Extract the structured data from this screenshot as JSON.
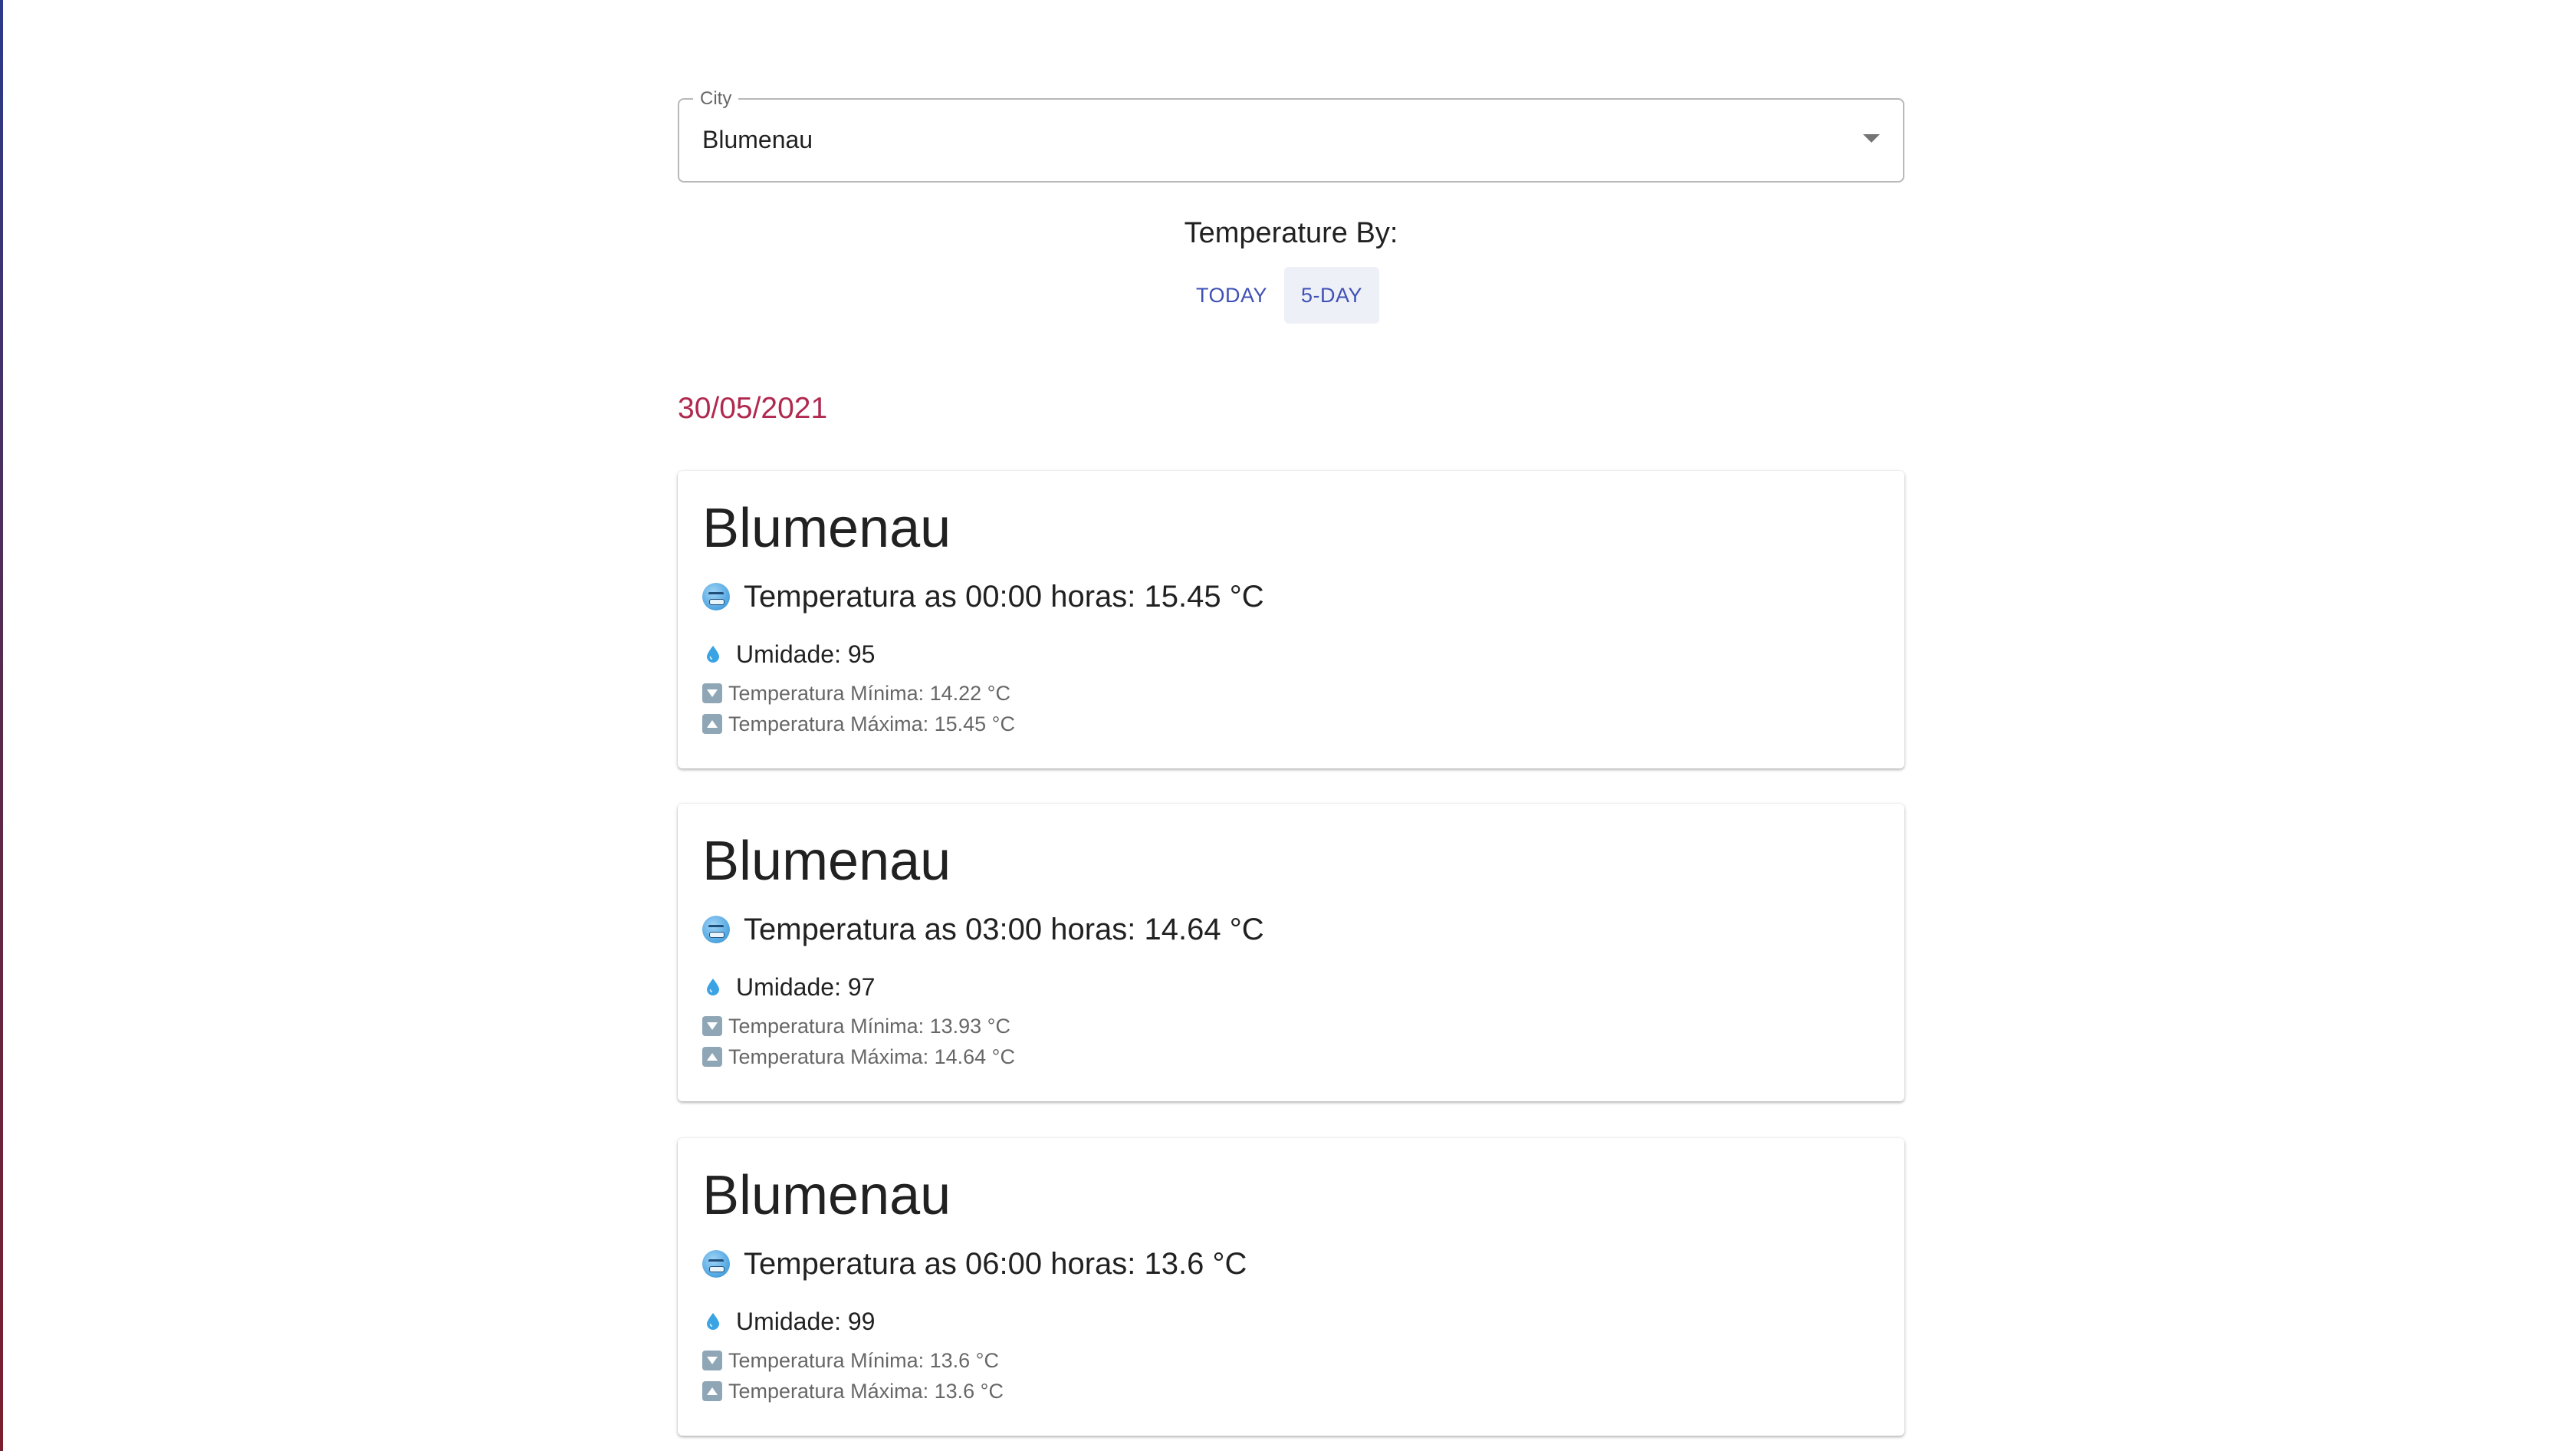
{
  "city_select": {
    "label": "City",
    "value": "Blumenau"
  },
  "temperature_by": {
    "heading": "Temperature By:",
    "options": [
      {
        "label": "TODAY",
        "selected": false
      },
      {
        "label": "5-DAY",
        "selected": true
      }
    ]
  },
  "date": "30/05/2021",
  "cards": [
    {
      "city": "Blumenau",
      "temperature": "Temperatura as 00:00 horas: 15.45 °C",
      "humidity": "Umidade: 95",
      "min": "Temperatura Mínima: 14.22 °C",
      "max": "Temperatura Máxima: 15.45 °C"
    },
    {
      "city": "Blumenau",
      "temperature": "Temperatura as 03:00 horas: 14.64 °C",
      "humidity": "Umidade: 97",
      "min": "Temperatura Mínima: 13.93 °C",
      "max": "Temperatura Máxima: 14.64 °C"
    },
    {
      "city": "Blumenau",
      "temperature": "Temperatura as 06:00 horas: 13.6 °C",
      "humidity": "Umidade: 99",
      "min": "Temperatura Mínima: 13.6 °C",
      "max": "Temperatura Máxima: 13.6 °C"
    }
  ],
  "icons": {
    "temperature": "cold-face-icon",
    "humidity": "droplet-icon",
    "min": "down-arrow-icon",
    "max": "up-arrow-icon"
  },
  "colors": {
    "accent": "#3f51b5",
    "date": "#b0294f"
  }
}
